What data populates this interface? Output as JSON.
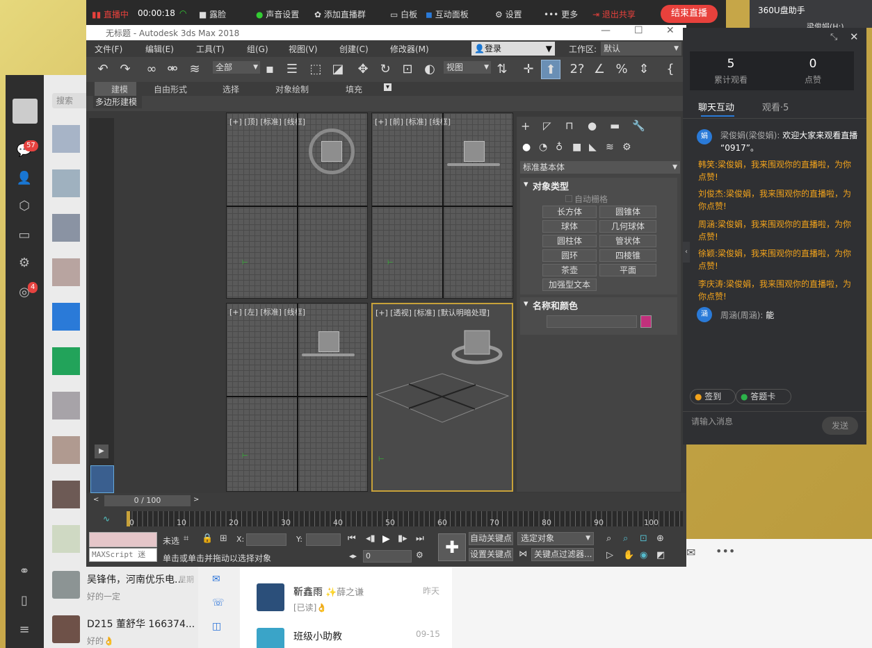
{
  "live_bar": {
    "status": "直播中",
    "time": "00:00:18",
    "items": [
      "露脸",
      "声音设置",
      "添加直播群",
      "白板",
      "互动面板",
      "设置",
      "更多"
    ],
    "exit_share": "退出共享",
    "end_live": "结束直播"
  },
  "top_right": {
    "title": "360U盘助手",
    "user": "梁俊娟(H:)"
  },
  "max": {
    "title": "无标题 - Autodesk 3ds Max 2018",
    "menus": [
      "文件(F)",
      "编辑(E)",
      "工具(T)",
      "组(G)",
      "视图(V)",
      "创建(C)",
      "修改器(M)"
    ],
    "login": "登录",
    "workspace_label": "工作区:",
    "workspace_value": "默认",
    "toolbar": {
      "filter": "全部",
      "view": "视图"
    },
    "ribbon_tabs": [
      "建模",
      "自由形式",
      "选择",
      "对象绘制",
      "填充"
    ],
    "ribbon_sub": "多边形建模",
    "viewports": [
      "[+] [顶] [标准] [线框]",
      "[+] [前] [标准] [线框]",
      "[+] [左] [标准] [线框]",
      "[+] [透视] [标准] [默认明暗处理]"
    ],
    "cmd": {
      "dropdown": "标准基本体",
      "object_type": "对象类型",
      "auto_grid": "自动栅格",
      "buttons": [
        "长方体",
        "圆锥体",
        "球体",
        "几何球体",
        "圆柱体",
        "管状体",
        "圆环",
        "四棱锥",
        "茶壶",
        "平面",
        "加强型文本"
      ],
      "name_color": "名称和颜色"
    },
    "timeline": {
      "frame": "0 / 100",
      "ticks": [
        "0",
        "10",
        "20",
        "30",
        "40",
        "50",
        "60",
        "70",
        "80",
        "90",
        "100"
      ]
    },
    "status": {
      "left": "未选",
      "maxscript": "MAXScript 迷",
      "hint": "单击或单击并拖动以选择对象",
      "x": "X:",
      "y": "Y:",
      "frame_value": "0",
      "auto_key": "自动关键点",
      "set_key": "设置关键点",
      "selected": "选定对象",
      "key_filter": "关键点过滤器..."
    }
  },
  "live_panel": {
    "total_views": "5",
    "total_views_label": "累计观看",
    "likes": "0",
    "likes_label": "点赞",
    "tab_chat": "聊天互动",
    "tab_watch": "观看·5",
    "messages": [
      {
        "avatar": "娟",
        "name": "梁俊娟(梁俊娟):",
        "text": "欢迎大家来观看直播 “0917”。",
        "type": "normal"
      },
      {
        "name": "韩笑:",
        "text": "梁俊娟，我来围观你的直播啦，为你点赞!",
        "type": "orange"
      },
      {
        "name": "刘俊杰:",
        "text": "梁俊娟，我来围观你的直播啦，为你点赞!",
        "type": "orange"
      },
      {
        "name": "周涵:",
        "text": "梁俊娟，我来围观你的直播啦，为你点赞!",
        "type": "orange"
      },
      {
        "name": "徐颖:",
        "text": "梁俊娟，我来围观你的直播啦，为你点赞!",
        "type": "orange"
      },
      {
        "name": "李庆涛:",
        "text": "梁俊娟，我来围观你的直播啦，为你点赞!",
        "type": "orange"
      },
      {
        "avatar": "涵",
        "name": "周涵(周涵):",
        "text": "能",
        "type": "normal"
      }
    ],
    "signin": "签到",
    "answer_card": "答题卡",
    "input_placeholder": "请输入消息",
    "send": "发送"
  },
  "chat_app": {
    "search": "搜索",
    "badge1": "57",
    "badge2": "4",
    "items": [
      {
        "name": "吴锋伟，河南优乐电...",
        "sub": "好的一定",
        "time": "星期"
      },
      {
        "name": "D215 董舒华  166374...",
        "sub": "好的👌",
        "time": ""
      }
    ],
    "mid": [
      {
        "name": "靳鑫雨",
        "tag": "✨薛之谦",
        "sub": "[已读]👌",
        "time": "昨天"
      },
      {
        "name": "班级小助教",
        "sub": "",
        "time": "09-15"
      }
    ]
  }
}
